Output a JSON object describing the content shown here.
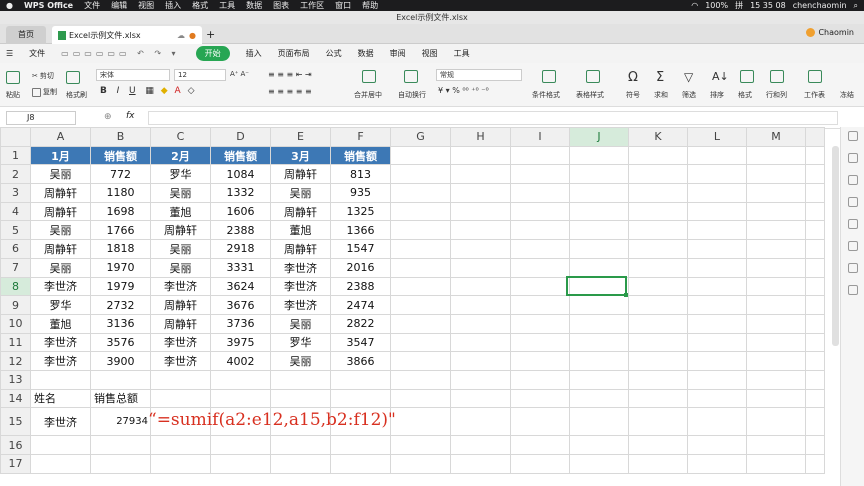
{
  "mac": {
    "apple": "",
    "app": "WPS Office",
    "menus": [
      "文件",
      "编辑",
      "视图",
      "插入",
      "格式",
      "工具",
      "数据",
      "图表",
      "工作区",
      "窗口",
      "帮助"
    ],
    "battery": "100%",
    "input": "拼",
    "time": "15 35 08",
    "user": "chenchaomin"
  },
  "window": {
    "title": "Excel示例文件.xlsx"
  },
  "tabs": {
    "home": "首页",
    "file": "Excel示例文件.xlsx",
    "plus": "+",
    "user": "Chaomin"
  },
  "menu": [
    "文件",
    "开始",
    "插入",
    "页面布局",
    "公式",
    "数据",
    "审阅",
    "视图",
    "工具"
  ],
  "ribbon": {
    "cut": "剪切",
    "paste": "粘贴",
    "copy": "复制",
    "format_painter": "格式刷",
    "font": "宋体",
    "size": "12",
    "bold": "B",
    "italic": "I",
    "underline": "U",
    "merge": "合并居中",
    "wrap": "自动换行",
    "numfmt": "常规",
    "cond": "条件格式",
    "table": "表格样式",
    "symbol": "符号",
    "sum": "求和",
    "filter": "筛选",
    "sort": "排序",
    "format": "格式",
    "rowcol": "行和列",
    "sheet": "工作表",
    "freeze": "冻结"
  },
  "formula_bar": {
    "cell": "J8",
    "fx": "fx",
    "content": ""
  },
  "sheet": {
    "columns": [
      "A",
      "B",
      "C",
      "D",
      "E",
      "F",
      "G",
      "H",
      "I",
      "J",
      "K",
      "L",
      "M"
    ],
    "header": [
      "1月",
      "销售额",
      "2月",
      "销售额",
      "3月",
      "销售额"
    ],
    "rows": [
      [
        "吴丽",
        "772",
        "罗华",
        "1084",
        "周静轩",
        "813"
      ],
      [
        "周静轩",
        "1180",
        "吴丽",
        "1332",
        "吴丽",
        "935"
      ],
      [
        "周静轩",
        "1698",
        "董旭",
        "1606",
        "周静轩",
        "1325"
      ],
      [
        "吴丽",
        "1766",
        "周静轩",
        "2388",
        "董旭",
        "1366"
      ],
      [
        "周静轩",
        "1818",
        "吴丽",
        "2918",
        "周静轩",
        "1547"
      ],
      [
        "吴丽",
        "1970",
        "吴丽",
        "3331",
        "李世济",
        "2016"
      ],
      [
        "李世济",
        "1979",
        "李世济",
        "3624",
        "李世济",
        "2388"
      ],
      [
        "罗华",
        "2732",
        "周静轩",
        "3676",
        "李世济",
        "2474"
      ],
      [
        "董旭",
        "3136",
        "周静轩",
        "3736",
        "吴丽",
        "2822"
      ],
      [
        "李世济",
        "3576",
        "李世济",
        "3975",
        "罗华",
        "3547"
      ],
      [
        "李世济",
        "3900",
        "李世济",
        "4002",
        "吴丽",
        "3866"
      ]
    ],
    "label_name": "姓名",
    "label_total": "销售总额",
    "a15": "李世济",
    "b15": "27934",
    "formula_text": "“=sumif(a2:e12,a15,b2:f12)\"",
    "selected_cell": "J8",
    "selected_col": "J",
    "selected_row": "8"
  }
}
